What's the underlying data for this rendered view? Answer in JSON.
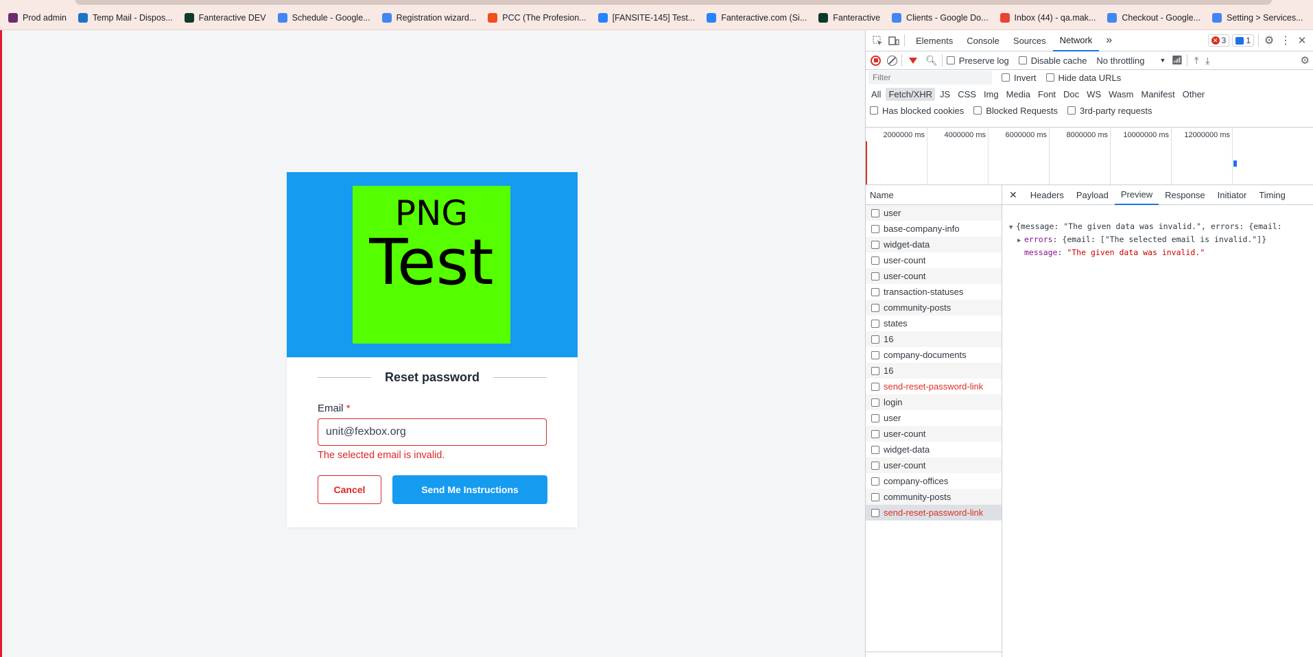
{
  "bookmarks": [
    {
      "label": "Prod admin",
      "color": "#6d2b6f"
    },
    {
      "label": "Temp Mail - Dispos...",
      "color": "#1a73c9"
    },
    {
      "label": "Fanteractive DEV",
      "color": "#0d3b2a"
    },
    {
      "label": "Schedule - Google...",
      "color": "#4285f4"
    },
    {
      "label": "Registration wizard...",
      "color": "#4285f4"
    },
    {
      "label": "PCC (The Profesion...",
      "color": "#f24e1e"
    },
    {
      "label": "[FANSITE-145] Test...",
      "color": "#2684ff"
    },
    {
      "label": "Fanteractive.com (Si...",
      "color": "#2684ff"
    },
    {
      "label": "Fanteractive",
      "color": "#0d3b2a"
    },
    {
      "label": "Clients - Google Do...",
      "color": "#4285f4"
    },
    {
      "label": "Inbox (44) - qa.mak...",
      "color": "#ea4335"
    },
    {
      "label": "Checkout - Google...",
      "color": "#4285f4"
    },
    {
      "label": "Setting > Services...",
      "color": "#4285f4"
    }
  ],
  "form": {
    "logo_line1": "PNG",
    "logo_line2": "Test",
    "title": "Reset password",
    "email_label": "Email",
    "required_mark": "*",
    "email_value": "unit@fexbox.org",
    "error": "The selected email is invalid.",
    "cancel": "Cancel",
    "send": "Send Me Instructions"
  },
  "devtools": {
    "tabs": [
      "Elements",
      "Console",
      "Sources",
      "Network"
    ],
    "more": "»",
    "errors_count": "3",
    "messages_count": "1",
    "preserve_log": "Preserve log",
    "disable_cache": "Disable cache",
    "throttling": "No throttling",
    "filter_placeholder": "Filter",
    "invert": "Invert",
    "hide_data_urls": "Hide data URLs",
    "types": [
      "All",
      "Fetch/XHR",
      "JS",
      "CSS",
      "Img",
      "Media",
      "Font",
      "Doc",
      "WS",
      "Wasm",
      "Manifest",
      "Other"
    ],
    "has_blocked_cookies": "Has blocked cookies",
    "blocked_requests": "Blocked Requests",
    "third_party": "3rd-party requests",
    "ticks": [
      "2000000 ms",
      "4000000 ms",
      "6000000 ms",
      "8000000 ms",
      "10000000 ms",
      "12000000 ms"
    ],
    "name_header": "Name",
    "requests": [
      {
        "name": "user",
        "error": false
      },
      {
        "name": "base-company-info",
        "error": false
      },
      {
        "name": "widget-data",
        "error": false
      },
      {
        "name": "user-count",
        "error": false
      },
      {
        "name": "user-count",
        "error": false
      },
      {
        "name": "transaction-statuses",
        "error": false
      },
      {
        "name": "community-posts",
        "error": false
      },
      {
        "name": "states",
        "error": false
      },
      {
        "name": "16",
        "error": false
      },
      {
        "name": "company-documents",
        "error": false
      },
      {
        "name": "16",
        "error": false
      },
      {
        "name": "send-reset-password-link",
        "error": true
      },
      {
        "name": "login",
        "error": false
      },
      {
        "name": "user",
        "error": false
      },
      {
        "name": "user-count",
        "error": false
      },
      {
        "name": "widget-data",
        "error": false
      },
      {
        "name": "user-count",
        "error": false
      },
      {
        "name": "company-offices",
        "error": false
      },
      {
        "name": "community-posts",
        "error": false
      },
      {
        "name": "send-reset-password-link",
        "error": true,
        "selected": true
      }
    ],
    "detail_close": "✕",
    "detail_tabs": [
      "Headers",
      "Payload",
      "Preview",
      "Response",
      "Initiator",
      "Timing"
    ],
    "preview": {
      "line1": "{message: \"The given data was invalid.\", errors: {email:",
      "errors_key": "errors",
      "errors_val": "{email: [\"The selected email is invalid.\"]}",
      "message_key": "message",
      "message_val": "\"The given data was invalid.\""
    }
  }
}
